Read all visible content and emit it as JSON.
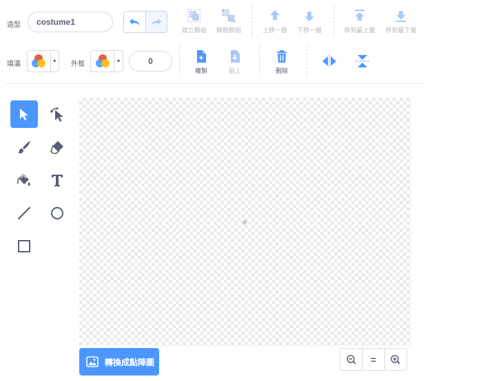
{
  "row1": {
    "costume_label": "造型",
    "costume_name": "costume1",
    "group_label": "建立群組",
    "ungroup_label": "解散群組",
    "forward_label": "上移一層",
    "backward_label": "下移一層",
    "front_label": "移到最上層",
    "back_label": "移到最下層"
  },
  "row2": {
    "fill_label": "填滿",
    "outline_label": "外框",
    "outline_width": "0",
    "copy_label": "複製",
    "paste_label": "貼上",
    "delete_label": "刪除"
  },
  "tools": [
    "select-tool",
    "reshape-tool",
    "brush-tool",
    "eraser-tool",
    "fill-tool",
    "text-tool",
    "line-tool",
    "circle-tool",
    "rectangle-tool"
  ],
  "footer": {
    "convert_label": "轉換成點陣圖",
    "zoom_reset_label": "="
  },
  "colors": {
    "accent": "#4c97ff",
    "text": "#575e75",
    "disabled": "#b5b9c3",
    "delete": "#4c97ff"
  }
}
